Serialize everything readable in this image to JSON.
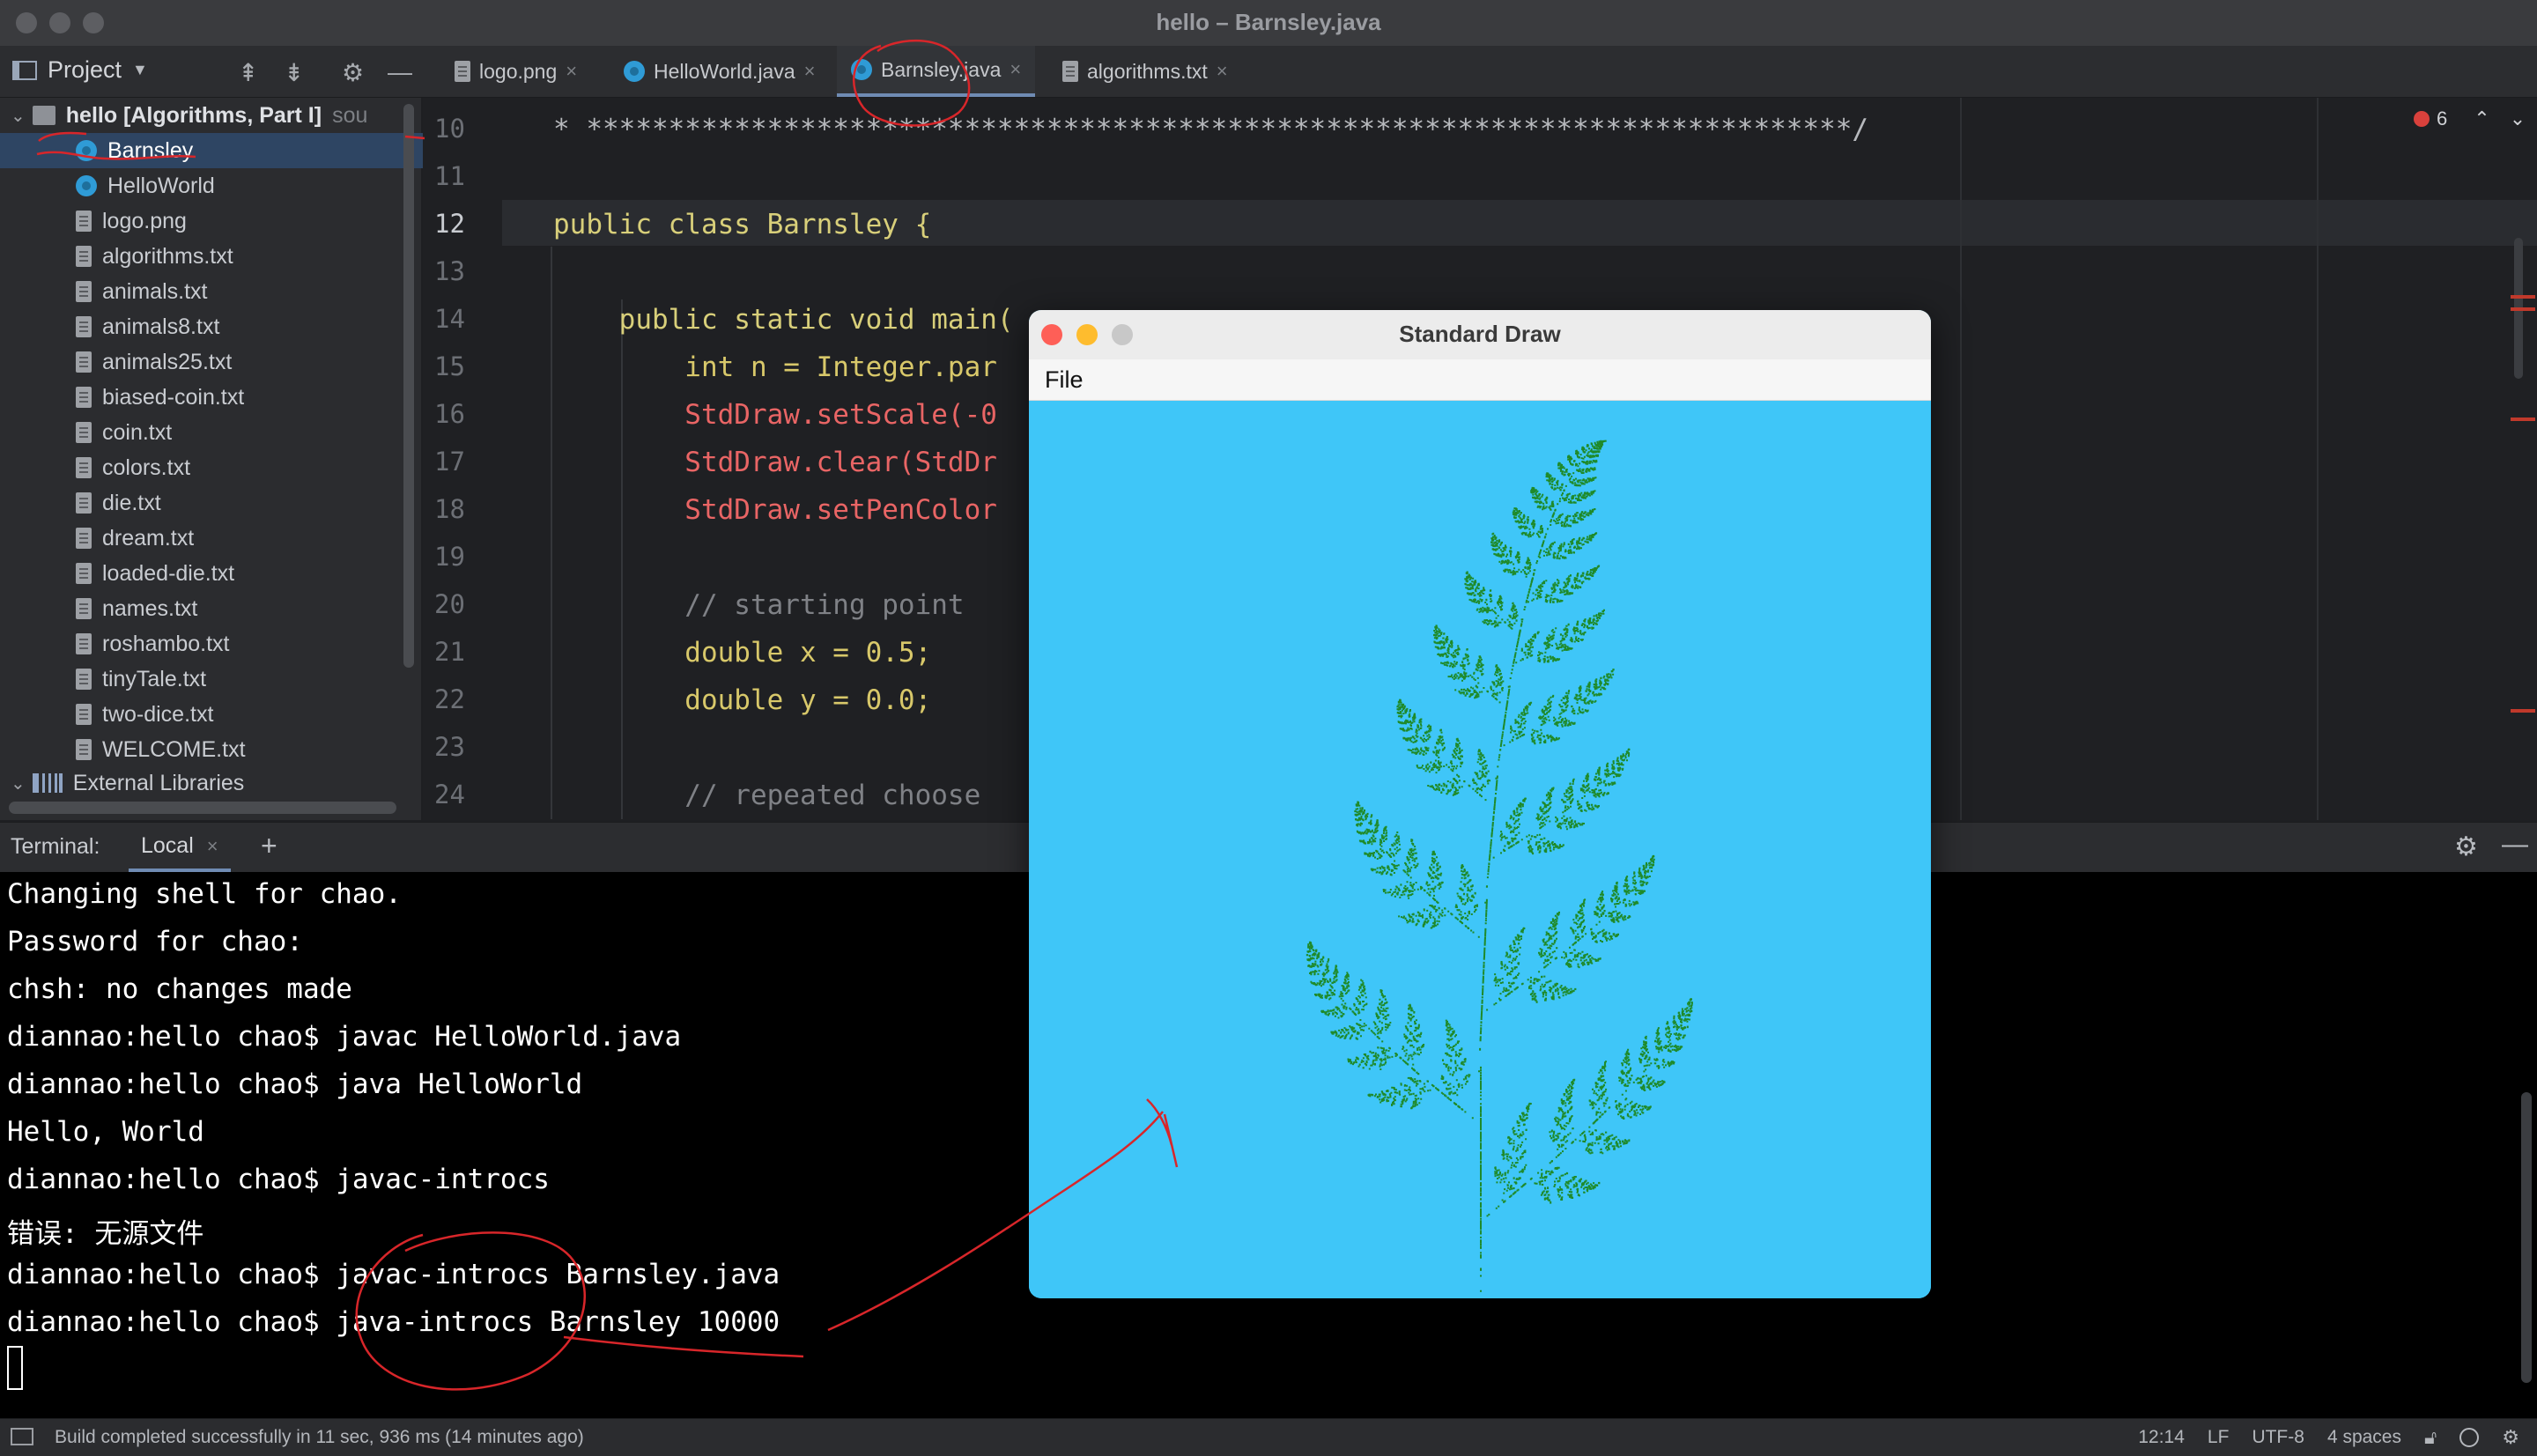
{
  "window": {
    "title": "hello – Barnsley.java"
  },
  "project_panel": {
    "header": "Project",
    "root": {
      "name": "hello [Algorithms, Part I]",
      "suffix": "sou"
    },
    "items": [
      {
        "label": "Barnsley",
        "kind": "java",
        "selected": true
      },
      {
        "label": "HelloWorld",
        "kind": "java"
      },
      {
        "label": "logo.png",
        "kind": "file"
      },
      {
        "label": "algorithms.txt",
        "kind": "file"
      },
      {
        "label": "animals.txt",
        "kind": "file"
      },
      {
        "label": "animals8.txt",
        "kind": "file"
      },
      {
        "label": "animals25.txt",
        "kind": "file"
      },
      {
        "label": "biased-coin.txt",
        "kind": "file"
      },
      {
        "label": "coin.txt",
        "kind": "file"
      },
      {
        "label": "colors.txt",
        "kind": "file"
      },
      {
        "label": "die.txt",
        "kind": "file"
      },
      {
        "label": "dream.txt",
        "kind": "file"
      },
      {
        "label": "loaded-die.txt",
        "kind": "file"
      },
      {
        "label": "names.txt",
        "kind": "file"
      },
      {
        "label": "roshambo.txt",
        "kind": "file"
      },
      {
        "label": "tinyTale.txt",
        "kind": "file"
      },
      {
        "label": "two-dice.txt",
        "kind": "file"
      },
      {
        "label": "WELCOME.txt",
        "kind": "file"
      }
    ],
    "external_libraries": "External Libraries"
  },
  "editor_tabs": [
    {
      "label": "logo.png",
      "kind": "file"
    },
    {
      "label": "HelloWorld.java",
      "kind": "java"
    },
    {
      "label": "Barnsley.java",
      "kind": "java",
      "active": true
    },
    {
      "label": "algorithms.txt",
      "kind": "file"
    }
  ],
  "editor": {
    "error_count": "6",
    "current_line": "12",
    "lines": [
      {
        "num": "10",
        "text": "* *****************************************************************************/"
      },
      {
        "num": "11",
        "text": ""
      },
      {
        "num": "12",
        "text": "public class Barnsley {"
      },
      {
        "num": "13",
        "text": ""
      },
      {
        "num": "14",
        "text": "    public static void main("
      },
      {
        "num": "15",
        "text": "        int n = Integer.par"
      },
      {
        "num": "16",
        "text": "        StdDraw.setScale(-0"
      },
      {
        "num": "17",
        "text": "        StdDraw.clear(StdDr"
      },
      {
        "num": "18",
        "text": "        StdDraw.setPenColor"
      },
      {
        "num": "19",
        "text": ""
      },
      {
        "num": "20",
        "text": "        // starting point"
      },
      {
        "num": "21",
        "text": "        double x = 0.5;"
      },
      {
        "num": "22",
        "text": "        double y = 0.0;"
      },
      {
        "num": "23",
        "text": ""
      },
      {
        "num": "24",
        "text": "        // repeated choose"
      }
    ]
  },
  "terminal": {
    "label": "Terminal:",
    "tab": "Local",
    "lines": [
      "Changing shell for chao.",
      "Password for chao:",
      "chsh: no changes made",
      "diannao:hello chao$ javac HelloWorld.java",
      "diannao:hello chao$ java HelloWorld",
      "Hello, World",
      "diannao:hello chao$ javac-introcs",
      "错误: 无源文件",
      "diannao:hello chao$ javac-introcs Barnsley.java",
      "diannao:hello chao$ java-introcs Barnsley 10000"
    ]
  },
  "status_bar": {
    "message": "Build completed successfully in 11 sec, 936 ms (14 minutes ago)",
    "position": "12:14",
    "line_sep": "LF",
    "encoding": "UTF-8",
    "indent": "4 spaces"
  },
  "std_draw": {
    "title": "Standard Draw",
    "menu": "File",
    "background": "#3fc6f8",
    "fern_color": "#1f8a2a",
    "points": "10000"
  },
  "colors": {
    "annotation_red": "#d8262a",
    "selection": "#2e4563",
    "accent_tab": "#6f8bb3"
  }
}
